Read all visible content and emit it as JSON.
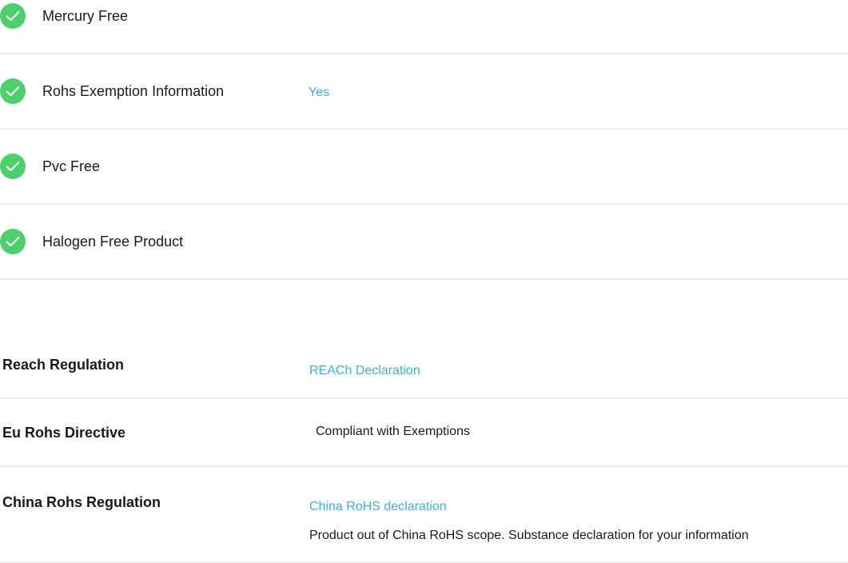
{
  "checklist": [
    {
      "label": "Mercury Free",
      "value": ""
    },
    {
      "label": "Rohs Exemption Information",
      "value": "Yes"
    },
    {
      "label": "Pvc Free",
      "value": ""
    },
    {
      "label": "Halogen Free Product",
      "value": ""
    }
  ],
  "regulations": [
    {
      "label": "Reach Regulation",
      "link": "REACh Declaration"
    },
    {
      "label": "Eu Rohs Directive",
      "text": "Compliant with Exemptions"
    },
    {
      "label": "China Rohs Regulation",
      "link": "China RoHS declaration",
      "note": "Product out of China RoHS scope. Substance declaration for your information"
    }
  ],
  "colors": {
    "check_icon": "#4cd06b",
    "link": "#3ab0dd",
    "divider": "#ececec"
  },
  "icons": {
    "check": "check-circle-icon"
  }
}
